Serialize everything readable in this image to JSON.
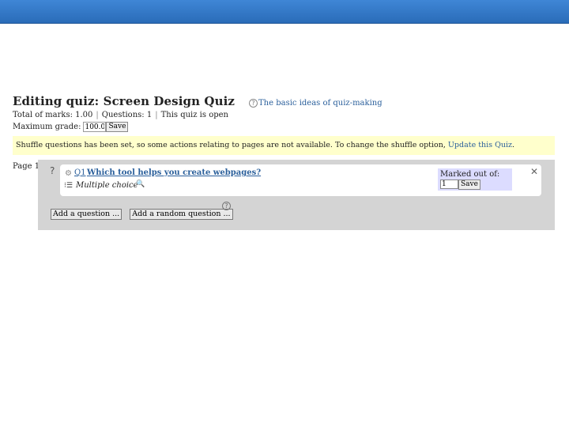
{
  "page": {
    "title": "Editing quiz: Screen Design Quiz",
    "help_link": "The basic ideas of quiz-making"
  },
  "summary": {
    "total_marks_label": "Total of marks: 1.00",
    "questions_label": "Questions: 1",
    "status": "This quiz is open",
    "max_grade_label": "Maximum grade:",
    "max_grade_value": "100.0",
    "save_label": "Save"
  },
  "notice": {
    "text": "Shuffle questions has been set, so some actions relating to pages are not available. To change the shuffle option,",
    "link": "Update this Quiz",
    "tail": "."
  },
  "section": {
    "page_label": "Page 1",
    "help_mark": "?",
    "question": {
      "number": "Q1",
      "text": "Which tool helps you create webpages?",
      "type": "Multiple choice",
      "marks_label": "Marked out of:",
      "marks_value": "1",
      "save_label": "Save"
    },
    "add_question_label": "Add a question ...",
    "add_random_label": "Add a random question ..."
  },
  "colors": {
    "topbar": "#2a6cb8",
    "link": "#2a5f9b",
    "notice_bg": "#ffffcc",
    "marks_bg": "#dcdcff",
    "section_bg": "#d4d4d4"
  }
}
